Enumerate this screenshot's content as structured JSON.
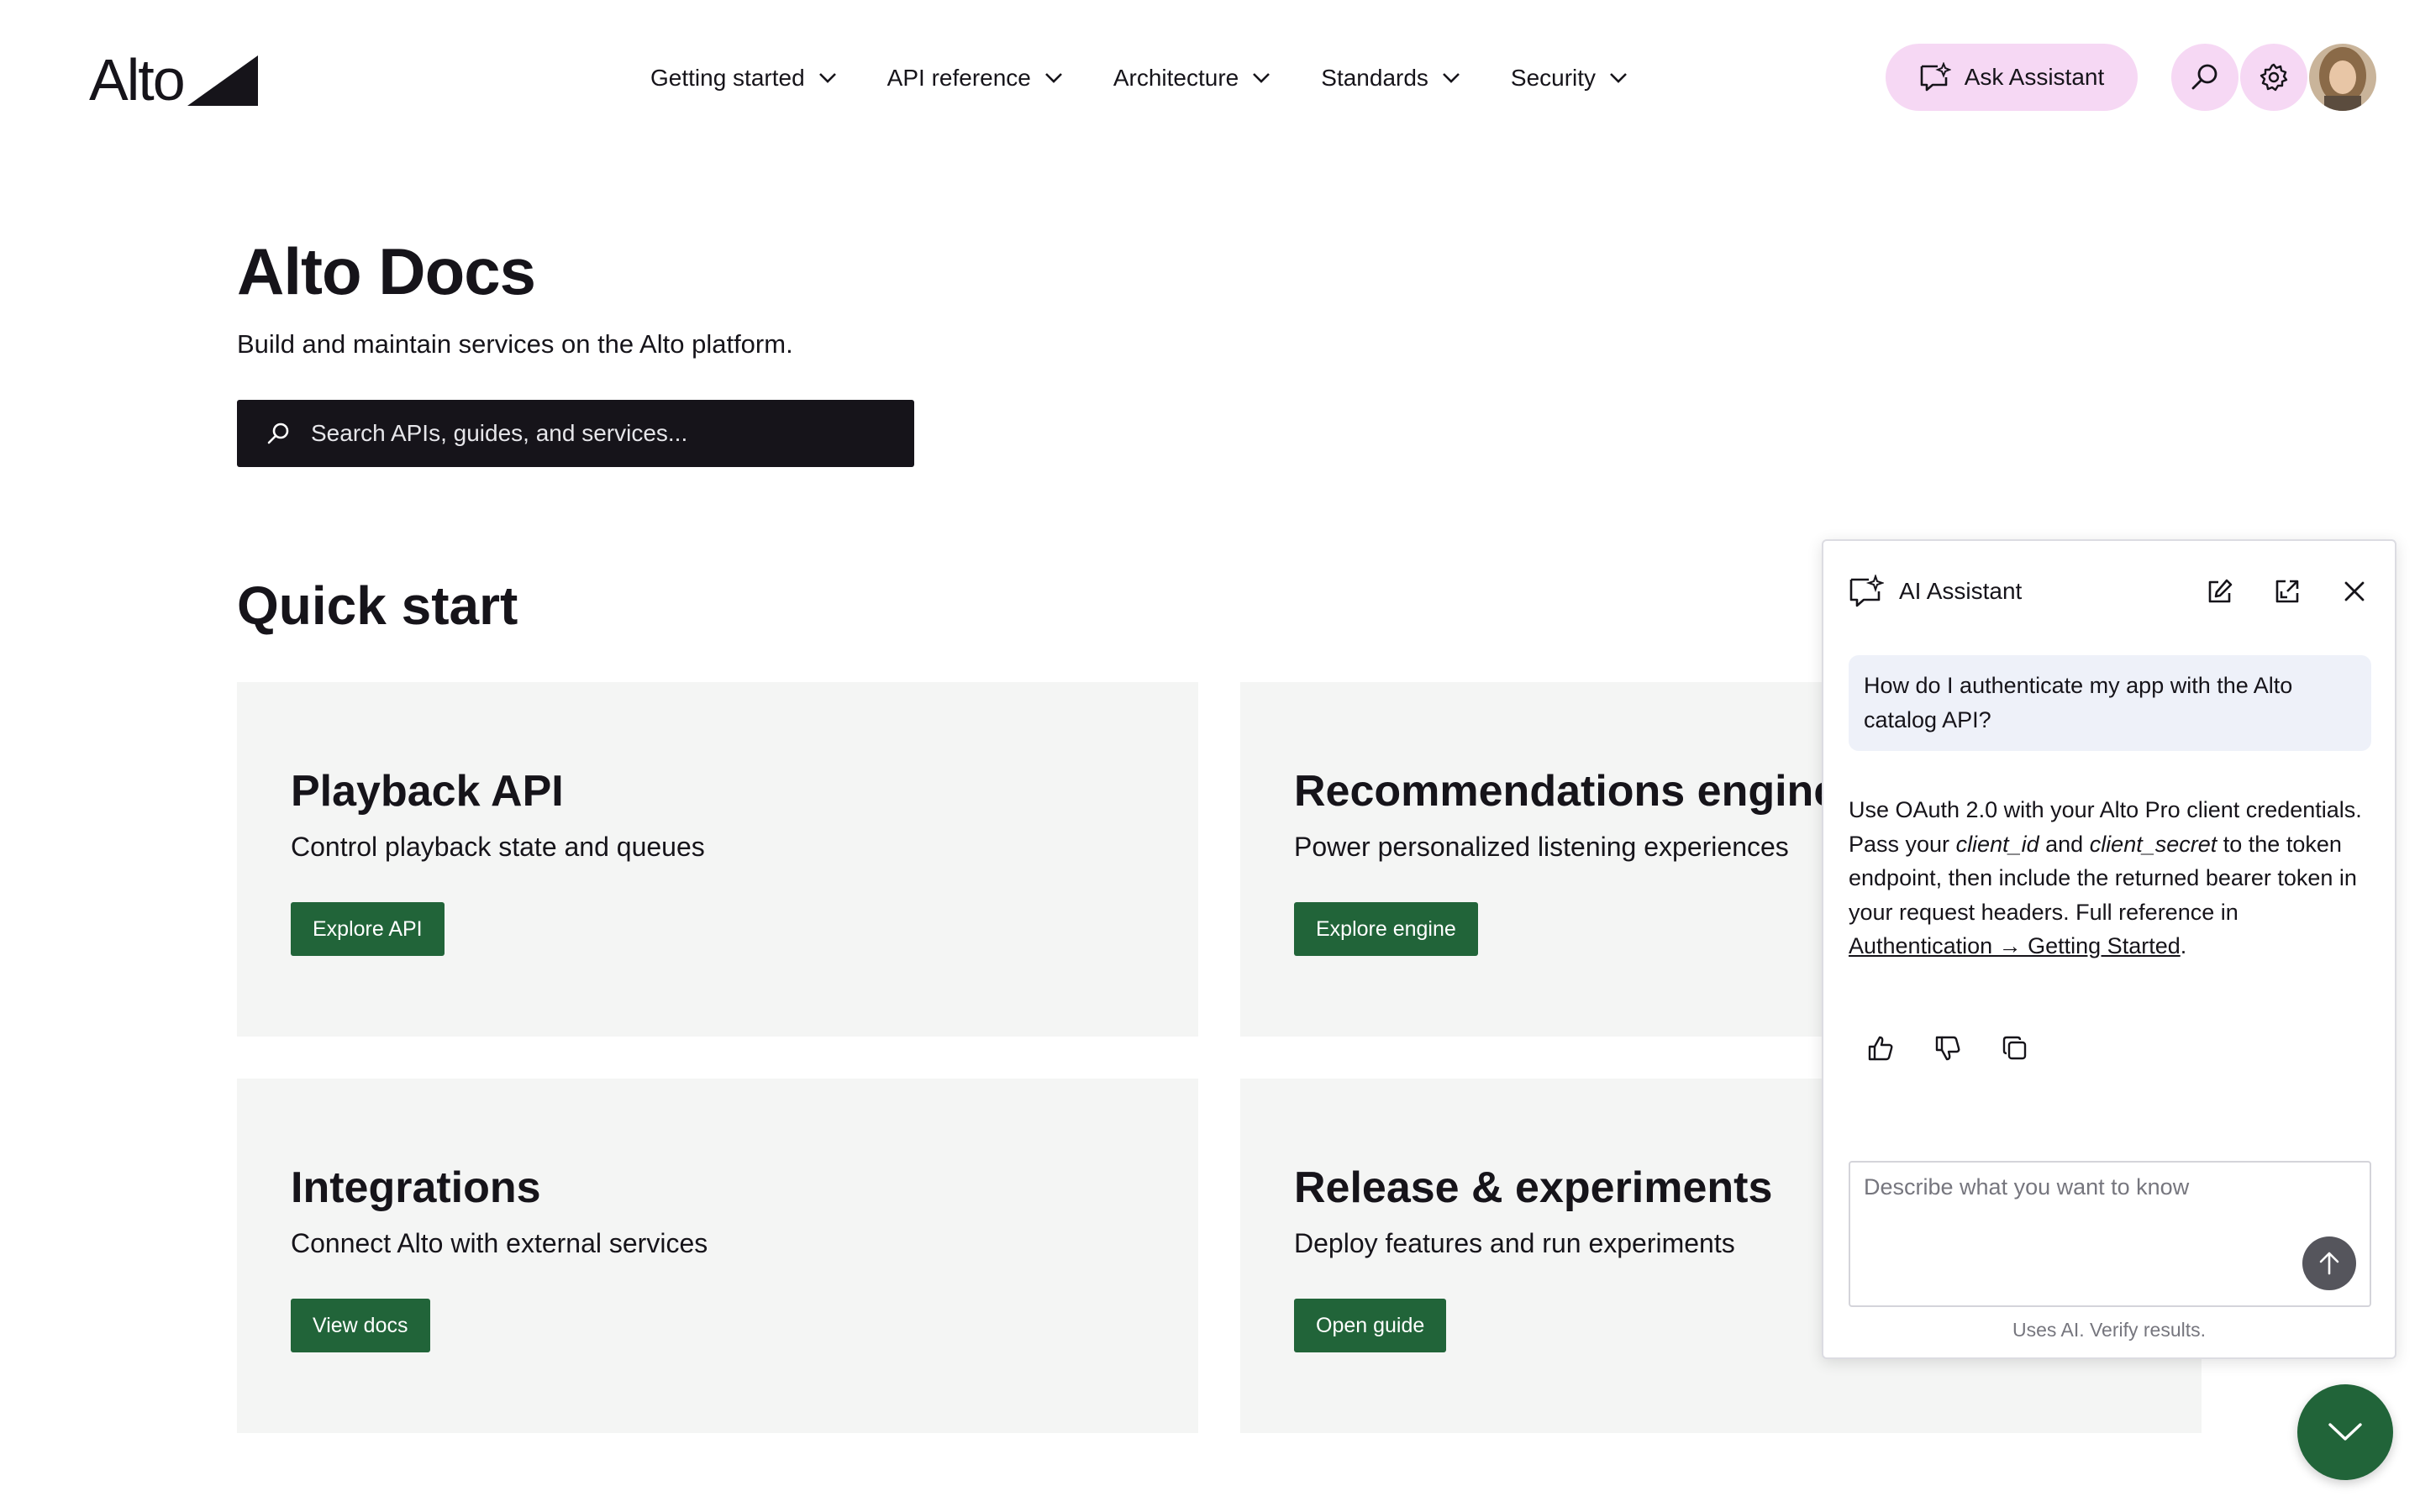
{
  "header": {
    "logo_text": "Alto",
    "nav": [
      {
        "label": "Getting started"
      },
      {
        "label": "API reference"
      },
      {
        "label": "Architecture"
      },
      {
        "label": "Standards"
      },
      {
        "label": "Security"
      }
    ],
    "ask_label": "Ask Assistant",
    "accent_color": "#f6d8f4"
  },
  "hero": {
    "title": "Alto Docs",
    "subtitle": "Build and maintain services on the Alto platform.",
    "search_placeholder": "Search APIs, guides, and services..."
  },
  "quick_start": {
    "title": "Quick start",
    "cards": [
      {
        "title": "Playback API",
        "description": "Control playback state and queues",
        "button": "Explore API"
      },
      {
        "title": "Recommendations engine",
        "description": "Power personalized listening experiences",
        "button": "Explore engine"
      },
      {
        "title": "Integrations",
        "description": "Connect Alto with external services",
        "button": "View docs"
      },
      {
        "title": "Release & experiments",
        "description": "Deploy features and run experiments",
        "button": "Open guide"
      }
    ],
    "button_color": "#216439"
  },
  "assistant": {
    "title": "AI Assistant",
    "user_question": "How do I authenticate my app with the Alto catalog API?",
    "answer": {
      "part1": "Use OAuth 2.0 with your Alto Pro client credentials. Pass your ",
      "client_id": "client_id",
      "part2": " and ",
      "client_secret": "client_secret",
      "part3": " to the token endpoint, then include the returned bearer token in your request headers. Full reference in ",
      "link": "Authentication → Getting Started",
      "part4": "."
    },
    "input_placeholder": "Describe what you want to know",
    "disclaimer": "Uses AI. Verify results."
  }
}
